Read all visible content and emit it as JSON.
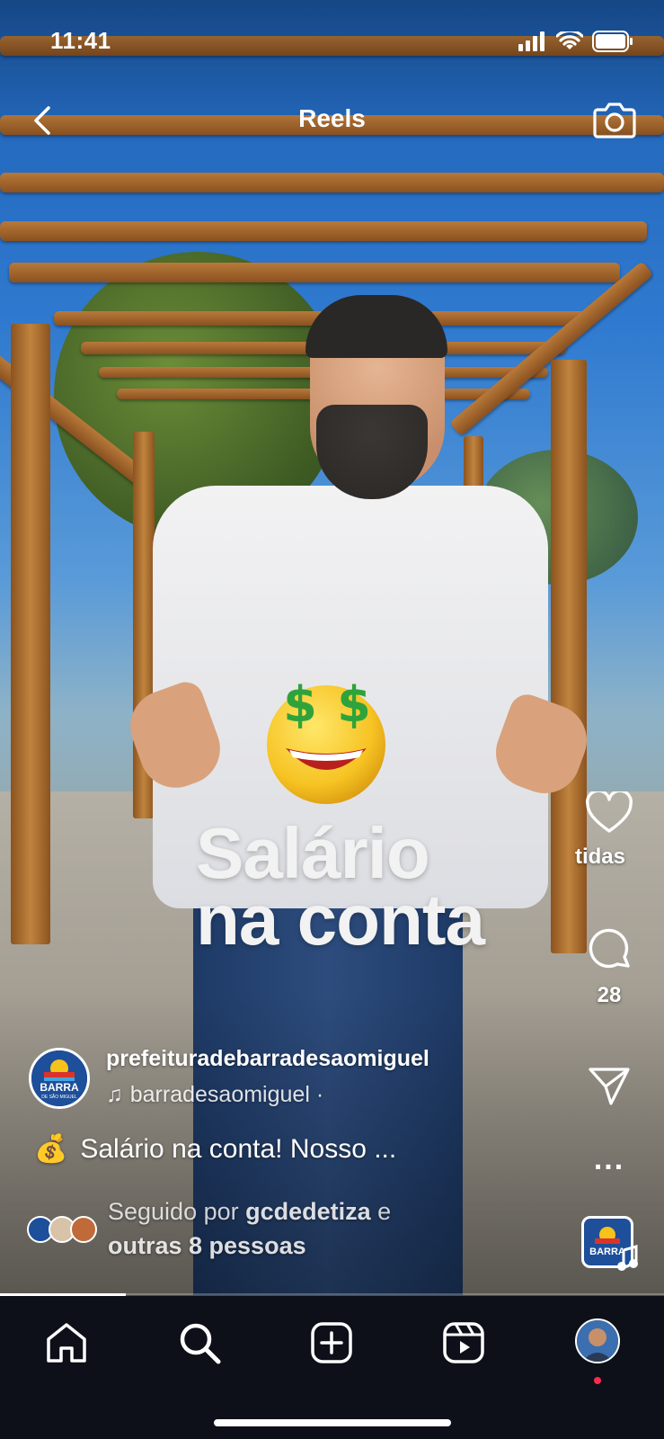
{
  "status_bar": {
    "time": "11:41"
  },
  "header": {
    "title": "Reels",
    "back_icon": "chevron-left-icon",
    "camera_icon": "camera-icon"
  },
  "overlay": {
    "line1": "Salário",
    "line2": "na conta",
    "emoji": "money-mouth-face"
  },
  "actions": {
    "like_label": "tidas",
    "comment_count": "28",
    "more_label": "..."
  },
  "post": {
    "author": "prefeituradebarradesaomiguel",
    "audio": "barradesaomiguel ·",
    "caption_emoji": "💰",
    "caption": "Salário na conta! Nosso ...",
    "followed_prefix": "Seguido por ",
    "followed_user": "gcdedetiza",
    "followed_mid": " e",
    "followed_rest": "outras 8 pessoas",
    "logo_text": "BARRA",
    "logo_sub": "DE SÃO MIGUEL"
  },
  "video_progress": 0.19,
  "colors": {
    "tabbar": "#0d1018",
    "notification_dot": "#ff2a4a",
    "logo_blue": "#1d4f9a"
  }
}
